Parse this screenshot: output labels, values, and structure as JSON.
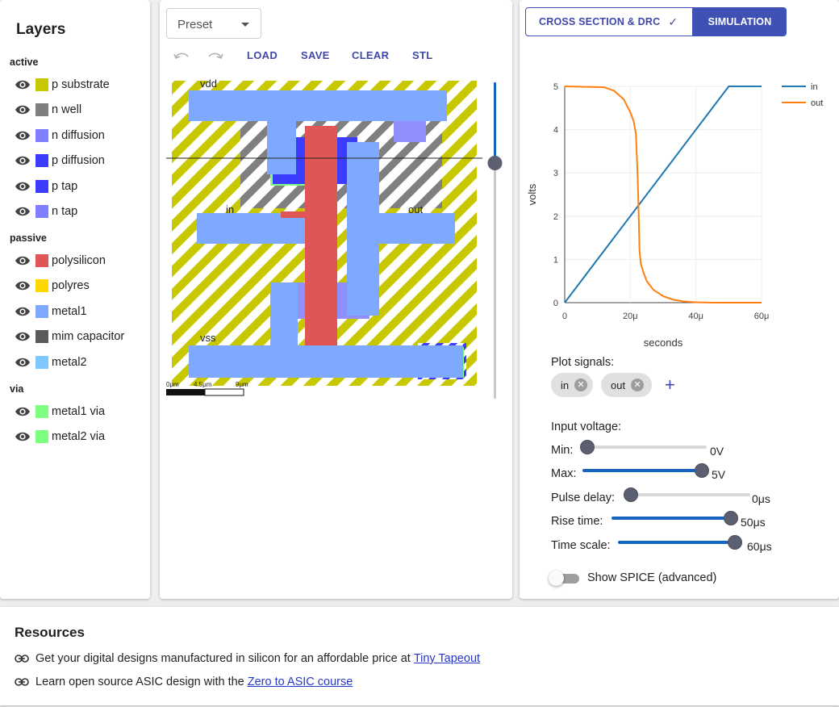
{
  "layers_panel": {
    "title": "Layers",
    "groups": [
      {
        "name": "active",
        "items": [
          {
            "label": "p substrate",
            "color": "#c8c800"
          },
          {
            "label": "n well",
            "color": "#7f7f7f"
          },
          {
            "label": "n diffusion",
            "color": "#7f7fff"
          },
          {
            "label": "p diffusion",
            "color": "#3c3cff"
          },
          {
            "label": "p tap",
            "color": "#3c3cff"
          },
          {
            "label": "n tap",
            "color": "#7f7fff"
          }
        ]
      },
      {
        "name": "passive",
        "items": [
          {
            "label": "polysilicon",
            "color": "#e05555"
          },
          {
            "label": "polyres",
            "color": "#ffd700"
          },
          {
            "label": "metal1",
            "color": "#7fa8ff"
          },
          {
            "label": "mim capacitor",
            "color": "#5a5a5a"
          },
          {
            "label": "metal2",
            "color": "#7fc8ff"
          }
        ]
      },
      {
        "name": "via",
        "items": [
          {
            "label": "metal1 via",
            "color": "#7fff7f"
          },
          {
            "label": "metal2 via",
            "color": "#7fff7f"
          }
        ]
      }
    ]
  },
  "editor": {
    "preset_label": "Preset",
    "toolbar": {
      "load": "LOAD",
      "save": "SAVE",
      "clear": "CLEAR",
      "stl": "STL"
    },
    "net_labels": {
      "vdd": "vdd",
      "in": "in",
      "out": "out",
      "vss": "vss"
    },
    "scale_bar": {
      "t0": "0μm",
      "t1": "4.5μm",
      "t2": "9μm"
    }
  },
  "simulation": {
    "tab_cross_section": "CROSS SECTION & DRC",
    "tab_cross_check": "✓",
    "tab_simulation": "SIMULATION",
    "plot_signals_label": "Plot signals:",
    "signal_chips": [
      "in",
      "out"
    ],
    "add_signal": "+",
    "chip_remove": "✕",
    "input_voltage_label": "Input voltage:",
    "sliders": [
      {
        "label": "Min:",
        "value_text": "0V",
        "fraction": 0.0
      },
      {
        "label": "Max:",
        "value_text": "5V",
        "fraction": 1.0
      },
      {
        "label": "Pulse delay:",
        "value_text": "0μs",
        "fraction": 0.0
      },
      {
        "label": "Rise time:",
        "value_text": "50μs",
        "fraction": 1.0
      },
      {
        "label": "Time scale:",
        "value_text": "60μs",
        "fraction": 1.0
      }
    ],
    "show_spice_label": "Show SPICE (advanced)",
    "show_spice_on": false
  },
  "chart_data": {
    "type": "line",
    "xlabel": "seconds",
    "ylabel": "volts",
    "xlim": [
      0,
      60
    ],
    "ylim": [
      0,
      5
    ],
    "x_ticks": [
      {
        "v": 0,
        "label": "0"
      },
      {
        "v": 20,
        "label": "20μ"
      },
      {
        "v": 40,
        "label": "40μ"
      },
      {
        "v": 60,
        "label": "60μ"
      }
    ],
    "y_ticks": [
      0,
      1,
      2,
      3,
      4,
      5
    ],
    "grid": true,
    "legend": "top-right",
    "series": [
      {
        "name": "in",
        "color": "#1f77b4",
        "x": [
          0,
          50,
          60
        ],
        "y": [
          0,
          5,
          5
        ]
      },
      {
        "name": "out",
        "color": "#ff7f0e",
        "x": [
          0,
          12,
          15,
          18,
          20,
          21,
          21.7,
          22.2,
          22.5,
          22.8,
          23.2,
          24,
          25,
          27,
          30,
          33,
          36,
          40,
          45,
          60
        ],
        "y": [
          5,
          4.98,
          4.9,
          4.7,
          4.4,
          4.2,
          3.9,
          3.0,
          2.2,
          1.2,
          0.9,
          0.7,
          0.5,
          0.3,
          0.15,
          0.07,
          0.03,
          0.01,
          0,
          0
        ]
      }
    ]
  },
  "resources": {
    "title": "Resources",
    "lines": [
      {
        "text": "Get your digital designs manufactured in silicon for an affordable price at",
        "link": "Tiny Tapeout"
      },
      {
        "text": "Learn open source ASIC design with the",
        "link": "Zero to ASIC course"
      }
    ]
  }
}
